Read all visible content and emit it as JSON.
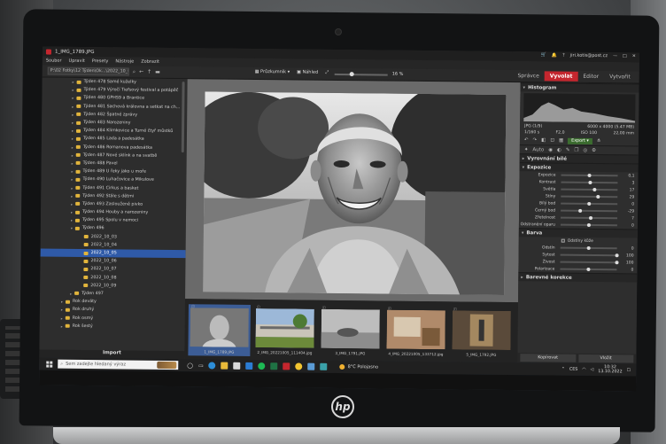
{
  "window": {
    "title": "1_IMG_1789.JPG",
    "user": "jiri.kotis@post.cz"
  },
  "menu": [
    "Soubor",
    "Upravit",
    "Presety",
    "Nástroje",
    "Zobrazit"
  ],
  "toolbar": {
    "path": "P:\\02 Fotky\\12 Týden\\Ok...\\2022_10_05",
    "view_mode": "Průzkumník",
    "preview": "Náhled",
    "zoom": "16 %",
    "zoom_level": 0.3
  },
  "mode_tabs": [
    {
      "label": "Správce",
      "active": false
    },
    {
      "label": "Vyvolat",
      "active": true
    },
    {
      "label": "Editor",
      "active": false
    },
    {
      "label": "Vytvořit",
      "active": false
    }
  ],
  "tree": [
    {
      "label": "Týden 478 Samé kuželky",
      "depth": 1,
      "arrow": "▸",
      "sel": false
    },
    {
      "label": "Týden 479 Výročí Tiefsový festival a potápěč",
      "depth": 1,
      "arrow": "▸",
      "sel": false
    },
    {
      "label": "Týden 480 GPHS9 a Brantice",
      "depth": 1,
      "arrow": "▸",
      "sel": false
    },
    {
      "label": "Týden 481 Sachová královna a setkat na ch...",
      "depth": 1,
      "arrow": "▸",
      "sel": false
    },
    {
      "label": "Týden 482 Špatné zprávy",
      "depth": 1,
      "arrow": "▸",
      "sel": false
    },
    {
      "label": "Týden 483 Narozeniny",
      "depth": 1,
      "arrow": "▸",
      "sel": false
    },
    {
      "label": "Týden 484 Klimkovice a Turné čtyř můstků",
      "depth": 1,
      "arrow": "▸",
      "sel": false
    },
    {
      "label": "Týden 485 Lada a padesátka",
      "depth": 1,
      "arrow": "▸",
      "sel": false
    },
    {
      "label": "Týden 486 Romanova padesátka",
      "depth": 1,
      "arrow": "▸",
      "sel": false
    },
    {
      "label": "Týden 487 Nové sklínk a na svatbě",
      "depth": 1,
      "arrow": "▸",
      "sel": false
    },
    {
      "label": "Týden 488 Pavel",
      "depth": 1,
      "arrow": "▸",
      "sel": false
    },
    {
      "label": "Týden 489 U řeky jako u moře",
      "depth": 1,
      "arrow": "▸",
      "sel": false
    },
    {
      "label": "Týden 490 Luhačovice a Mikulove",
      "depth": 1,
      "arrow": "▸",
      "sel": false
    },
    {
      "label": "Týden 491 Cirkus a basket",
      "depth": 1,
      "arrow": "▸",
      "sel": false
    },
    {
      "label": "Týden 492 Stále s dětmi",
      "depth": 1,
      "arrow": "▸",
      "sel": false
    },
    {
      "label": "Týden 493 Zaslouženě pivko",
      "depth": 1,
      "arrow": "▸",
      "sel": false
    },
    {
      "label": "Týden 494 Houby a narozeniny",
      "depth": 1,
      "arrow": "▸",
      "sel": false
    },
    {
      "label": "Týden 495 Spolu v nemoci",
      "depth": 1,
      "arrow": "▸",
      "sel": false
    },
    {
      "label": "Týden 496",
      "depth": 1,
      "arrow": "▾",
      "sel": false
    },
    {
      "label": "2022_10_03",
      "depth": 2,
      "arrow": "",
      "sel": false
    },
    {
      "label": "2022_10_04",
      "depth": 2,
      "arrow": "",
      "sel": false
    },
    {
      "label": "2022_10_05",
      "depth": 2,
      "arrow": "",
      "sel": true
    },
    {
      "label": "2022_10_06",
      "depth": 2,
      "arrow": "",
      "sel": false
    },
    {
      "label": "2022_10_07",
      "depth": 2,
      "arrow": "",
      "sel": false
    },
    {
      "label": "2022_10_08",
      "depth": 2,
      "arrow": "",
      "sel": false
    },
    {
      "label": "2022_10_09",
      "depth": 2,
      "arrow": "",
      "sel": false
    },
    {
      "label": "Týden 497",
      "depth": 1,
      "arrow": "▸",
      "sel": false
    },
    {
      "label": "Rok deváty",
      "depth": 0,
      "arrow": "▸",
      "sel": false
    },
    {
      "label": "Rok druhý",
      "depth": 0,
      "arrow": "▸",
      "sel": false
    },
    {
      "label": "Rok osmý",
      "depth": 0,
      "arrow": "▸",
      "sel": false
    },
    {
      "label": "Rok šestý",
      "depth": 0,
      "arrow": "▸",
      "sel": false
    }
  ],
  "import_label": "Import",
  "filmstrip": [
    {
      "name": "1_IMG_1789.JPG",
      "sel": true,
      "kind": "portrait"
    },
    {
      "name": "2_IMG_20221005_111404.jpg",
      "sel": false,
      "kind": "building"
    },
    {
      "name": "3_IMG_1791.JPG",
      "sel": false,
      "kind": "street"
    },
    {
      "name": "4_IMG_20221005_133712.jpg",
      "sel": false,
      "kind": "interior"
    },
    {
      "name": "5_IMG_1792.JPG",
      "sel": false,
      "kind": "elevator"
    }
  ],
  "panel": {
    "histogram_title": "Histogram",
    "file_info": {
      "name": "JPG",
      "index": "(1/9)",
      "dims": "6000 x 4000 (5.47 MB)",
      "shutter": "1/160 s",
      "aperture": "F2,0",
      "iso": "ISO 100",
      "focal": "22,00 mm"
    },
    "export_label": "Export",
    "auto_label": "Auto",
    "section_bw": "Vyrovnání bílé",
    "section_exposure": "Expozice",
    "exposure_sliders": [
      {
        "label": "Expozice",
        "value": "0,1",
        "pos": 0.5
      },
      {
        "label": "Kontrast",
        "value": "3",
        "pos": 0.52
      },
      {
        "label": "Světla",
        "value": "17",
        "pos": 0.6
      },
      {
        "label": "Stíny",
        "value": "29",
        "pos": 0.65
      },
      {
        "label": "Bílý bod",
        "value": "0",
        "pos": 0.5
      },
      {
        "label": "Černý bod",
        "value": "-29",
        "pos": 0.35
      },
      {
        "label": "Zřetelnost",
        "value": "7",
        "pos": 0.53
      },
      {
        "label": "Odstranění oparu",
        "value": "0",
        "pos": 0.5
      }
    ],
    "section_color": "Barva",
    "skin_tones": "Odstíny kůže",
    "color_sliders": [
      {
        "label": "Odstín",
        "value": "0",
        "pos": 0.5
      },
      {
        "label": "Sytost",
        "value": "100",
        "pos": 1.0
      },
      {
        "label": "Živost",
        "value": "100",
        "pos": 1.0
      },
      {
        "label": "Polarizace",
        "value": "0",
        "pos": 0.5
      }
    ],
    "section_color_corr": "Barevné korekce",
    "copy_btn": "Kopírovat",
    "paste_btn": "Vložit"
  },
  "taskbar": {
    "search_placeholder": "Sem zadejte hledaný výraz",
    "weather": "8°C  Polojasno",
    "lang": "CES",
    "time": "10:32",
    "date": "13.10.2022"
  }
}
